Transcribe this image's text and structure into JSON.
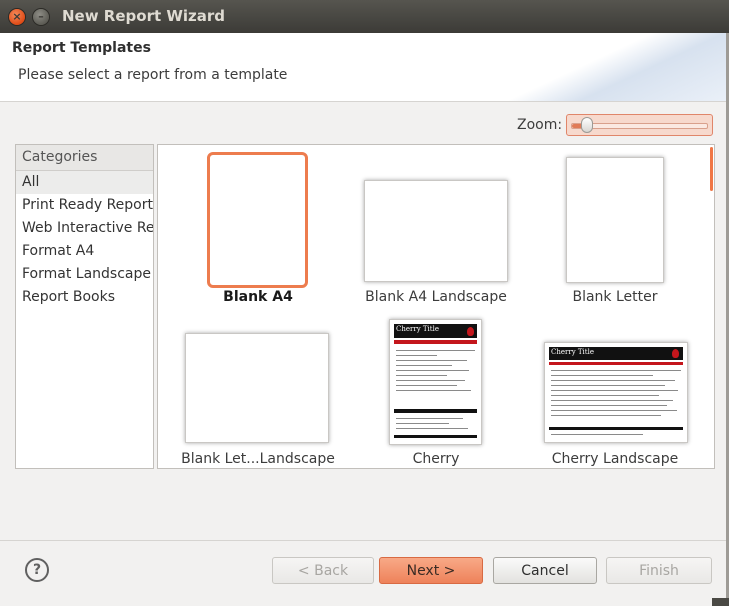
{
  "window": {
    "title": "New Report Wizard",
    "close_glyph": "×",
    "minimize_glyph": "–"
  },
  "header": {
    "title": "Report Templates",
    "description": "Please select a report from a template"
  },
  "zoom": {
    "label": "Zoom:",
    "level": 0.1
  },
  "categories": {
    "header": "Categories",
    "items": [
      {
        "label": "All",
        "selected": true
      },
      {
        "label": "Print Ready Reports"
      },
      {
        "label": "Web Interactive Reports"
      },
      {
        "label": "Format A4"
      },
      {
        "label": "Format Landscape"
      },
      {
        "label": "Report Books"
      }
    ]
  },
  "templates": [
    {
      "label": "Blank A4",
      "selected": true
    },
    {
      "label": "Blank A4 Landscape"
    },
    {
      "label": "Blank Letter"
    },
    {
      "label": "Blank Let...Landscape"
    },
    {
      "label": "Cherry",
      "preview_title": "Cherry Title"
    },
    {
      "label": "Cherry Landscape",
      "preview_title": "Cherry Title"
    }
  ],
  "buttons": {
    "help": "?",
    "back": "< Back",
    "next": "Next >",
    "cancel": "Cancel",
    "finish": "Finish"
  },
  "colors": {
    "accent": "#ed7c4e",
    "titlebar": "#3c3b37",
    "cherry_red": "#c4161c"
  }
}
